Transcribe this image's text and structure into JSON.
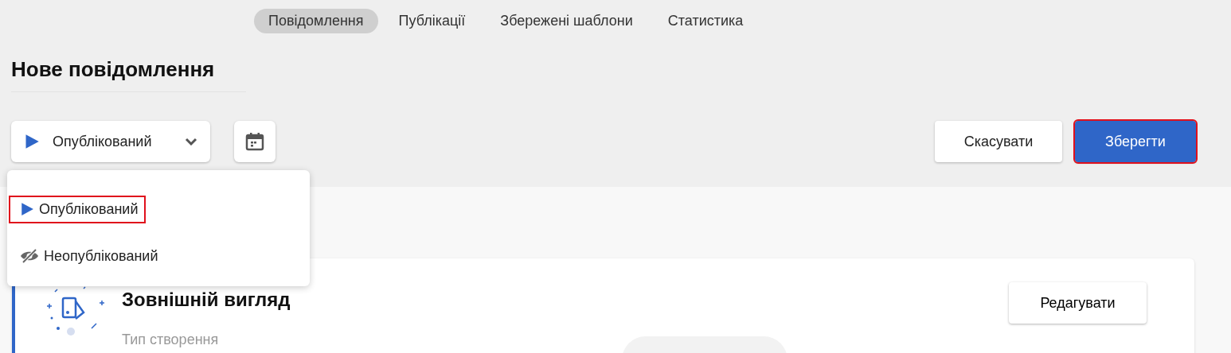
{
  "tabs": [
    {
      "label": "Повідомлення",
      "selected": true
    },
    {
      "label": "Публікації",
      "selected": false
    },
    {
      "label": "Збережені шаблони",
      "selected": false
    },
    {
      "label": "Статистика",
      "selected": false
    }
  ],
  "page_title": "Нове повідомлення",
  "status_select": {
    "kind": "published",
    "value": "Опублікований",
    "expanded": true
  },
  "actions": [
    {
      "label": "Скасувати",
      "kind": "secondary",
      "highlighted": false
    },
    {
      "label": "Зберегти",
      "kind": "primary",
      "highlighted": true
    }
  ],
  "status_menu": [
    {
      "kind": "published",
      "label": "Опублікований",
      "highlighted": true
    },
    {
      "kind": "unpublished",
      "label": "Неопублікований",
      "highlighted": false
    }
  ],
  "card": {
    "title": "Зовнішній вигляд",
    "edit_button": "Редагувати",
    "field_label": "Тип створення"
  }
}
